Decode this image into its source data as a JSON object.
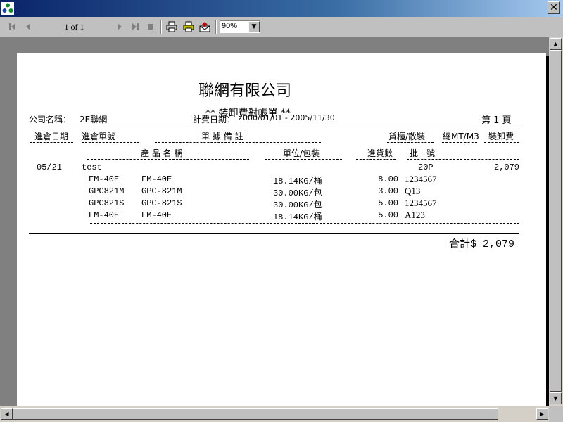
{
  "toolbar": {
    "page_indicator": "1 of 1",
    "zoom_value": "90%"
  },
  "report": {
    "company_title": "聯網有限公司",
    "report_title": "** 裝卸費對帳單 **",
    "company_label": "公司名稱：",
    "company_value": "2E聯網",
    "period_label": "計費日期：",
    "period_value": "2000/01/01 - 2005/11/30",
    "page_label": "第 1 頁",
    "headers_row1": {
      "in_date": "進倉日期",
      "in_no": "進倉單號",
      "remark": "單 據 備 註",
      "cabinet": "貨櫃/散裝",
      "total_mt": "總MT/M3",
      "fee": "裝卸費"
    },
    "headers_row2": {
      "product_name": "產 品 名 稱",
      "unit": "單位/包裝",
      "qty": "進貨數",
      "lot": "批　號"
    },
    "entry": {
      "date": "05/21",
      "ref": "test",
      "cabinet": "20P",
      "fee": "2,079"
    },
    "items": [
      {
        "code": "FM-40E",
        "name": "FM-40E",
        "unit": "18.14KG/桶",
        "qty": "8.00",
        "lot": "1234567"
      },
      {
        "code": "GPC821M",
        "name": "GPC-821M",
        "unit": "30.00KG/包",
        "qty": "3.00",
        "lot": "Q13"
      },
      {
        "code": "GPC821S",
        "name": "GPC-821S",
        "unit": "30.00KG/包",
        "qty": "5.00",
        "lot": "1234567"
      },
      {
        "code": "FM-40E",
        "name": "FM-40E",
        "unit": "18.14KG/桶",
        "qty": "5.00",
        "lot": "A123"
      }
    ],
    "total": "合計$ 2,079"
  }
}
